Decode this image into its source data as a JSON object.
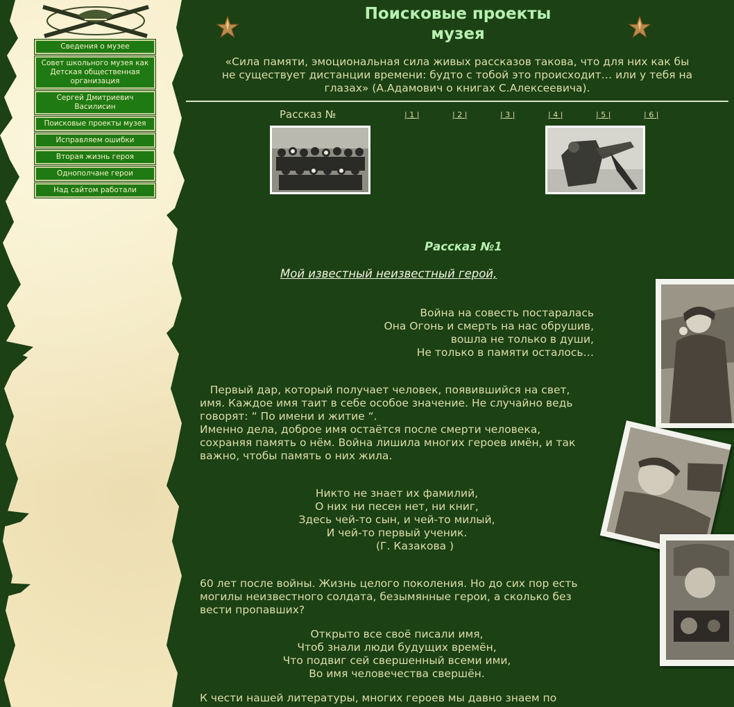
{
  "page": {
    "title_line1": "Поисковые проекты",
    "title_line2": "музея"
  },
  "menu": [
    {
      "label": "Сведения о музее"
    },
    {
      "label": "Совет школьного музея как Детская общественная организация"
    },
    {
      "label": "Сергей Дмитриевич Василисин"
    },
    {
      "label": "Поисковые проекты музея"
    },
    {
      "label": "Исправляем ошибки"
    },
    {
      "label": "Вторая жизнь героя"
    },
    {
      "label": "Однополчане герои"
    },
    {
      "label": "Над сайтом работали"
    }
  ],
  "quote": {
    "line1": "«Сила памяти, эмоциональная сила живых рассказов такова, что для них как бы",
    "line2": "не существует дистанции времени: будто с тобой это происходит… или у тебя на",
    "line3": "глазах» (А.Адамович о книгах С.Алексеевича)."
  },
  "story_nav": {
    "label": "Рассказ №",
    "links": [
      "| 1 |",
      "| 2 |",
      "| 3 |",
      "| 4 |",
      "| 5 |",
      "| 6 |"
    ]
  },
  "story": {
    "heading": "Рассказ №1",
    "subtitle": "Мой известный неизвестный герой,",
    "poem1": [
      "Война на совесть постаралась",
      "Она Огонь и смерть на нас обрушив,",
      "вошла не только в души,",
      "Не только в памяти осталось…"
    ],
    "para1": [
      "   Первый дар, который получает человек, появившийся на свет,",
      "имя. Каждое имя таит в себе особое значение. Не случайно ведь",
      "говорят: “ По имени и житие “.",
      "Именно дела, доброе имя остаётся после смерти человека,",
      "сохраняя память о нём. Война лишила многих героев имён, и так",
      "важно, чтобы память о них жила."
    ],
    "poem2": [
      "Никто не знает их фамилий,",
      "О них ни песен нет, ни книг,",
      "Здесь чей-то сын, и чей-то милый,",
      "И чей-то первый ученик.",
      "(Г. Казакова )"
    ],
    "para2": [
      "60 лет после войны. Жизнь целого поколения. Но до сих пор есть",
      "могилы неизвестного солдата, безымянные герои, а сколько без",
      "вести пропавших?"
    ],
    "poem3": [
      "Открыто все своё писали имя,",
      "Чтоб знали люди будущих времён,",
      "Что подвиг сей свершенный всеми ими,",
      "Во имя человечества свершён."
    ],
    "para3": [
      "К чести нашей литературы, многих героев мы давно знаем по"
    ]
  },
  "colors": {
    "background": "#1b4114",
    "parchment": "#f5e9c0",
    "menu_button": "#1f7a13",
    "title": "#b8f0b2",
    "text": "#ddddaa"
  },
  "icons": {
    "emblem": "crossed-rifles-emblem-icon",
    "stars": "bronze-star-icon"
  }
}
